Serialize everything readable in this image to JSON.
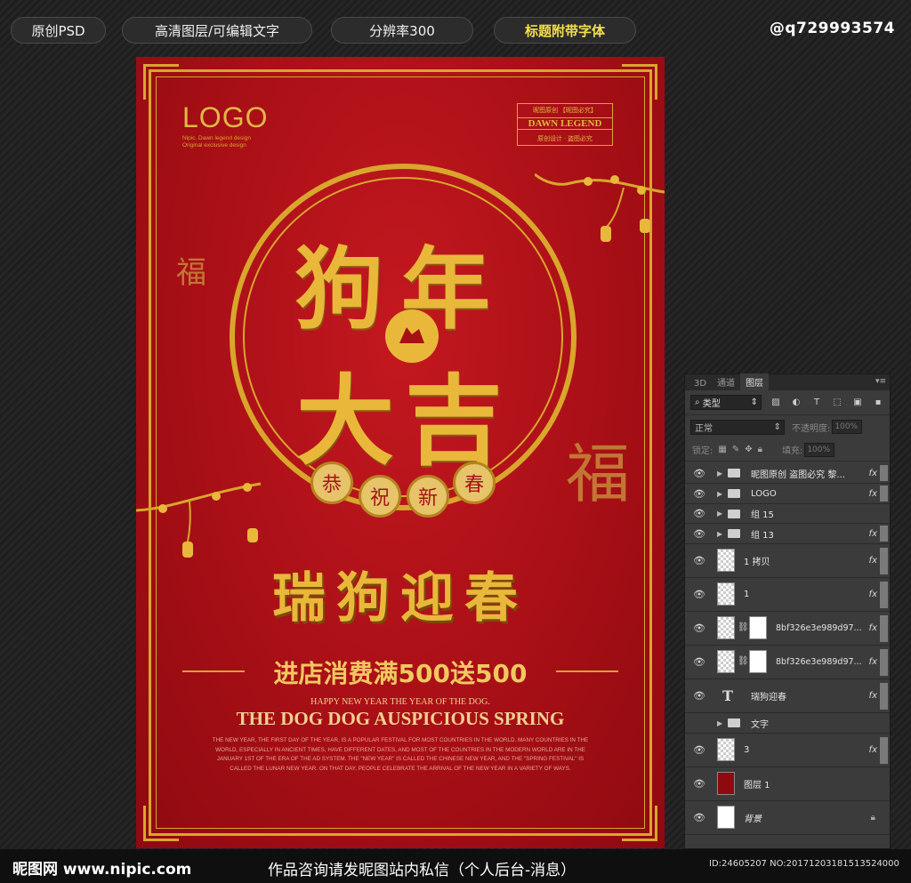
{
  "top_bar": {
    "pills": [
      "原创PSD",
      "高清图层/可编辑文字",
      "分辨率300",
      "标题附带字体"
    ],
    "handle": "@q729993574"
  },
  "poster": {
    "logo": "LOGO",
    "logo_sub": [
      "Nipic. Dawn legend design",
      "Original exclusive design"
    ],
    "dawn_box": {
      "line1": "昵图原创 【昵图必究】",
      "line2": "DAWN LEGEND",
      "line3": "原创设计 · 盗图必究"
    },
    "fu_char": "福",
    "title_chars": [
      "狗",
      "年",
      "大",
      "吉"
    ],
    "coins": [
      "恭",
      "祝",
      "新",
      "春"
    ],
    "slogan": "瑞狗迎春",
    "promo": "进店消费满500送500",
    "happy_line": "HAPPY NEW YEAR THE YEAR OF THE DOG.",
    "spring_line": "THE DOG DOG AUSPICIOUS SPRING",
    "paragraph": "THE NEW YEAR, THE FIRST DAY OF THE YEAR, IS A POPULAR FESTIVAL FOR MOST COUNTRIES IN THE WORLD. MANY COUNTRIES IN THE WORLD, ESPECIALLY IN ANCIENT TIMES, HAVE DIFFERENT DATES, AND MOST OF THE COUNTRIES IN THE MODERN WORLD ARE IN THE JANUARY 1ST OF THE ERA OF THE AD SYSTEM. THE \"NEW YEAR\" IS CALLED THE CHINESE NEW YEAR, AND THE \"SPRING FESTIVAL\" IS CALLED THE LUNAR NEW YEAR. ON THAT DAY, PEOPLE CELEBRATE THE ARRIVAL OF THE NEW YEAR IN A VARIETY OF WAYS."
  },
  "layers_panel": {
    "tabs": [
      "3D",
      "通道",
      "图层"
    ],
    "kind_select": "类型",
    "blend_mode": "正常",
    "opacity_label": "不透明度:",
    "opacity_value": "100%",
    "lock_label": "锁定:",
    "fill_label": "填充:",
    "fill_value": "100%",
    "fx_label": "fx",
    "text_layer_glyph": "T",
    "layers": [
      {
        "name": "昵图原创 盗图必究 黎..."
      },
      {
        "name": "LOGO"
      },
      {
        "name": "组 15"
      },
      {
        "name": "组 13"
      },
      {
        "name": "1 拷贝"
      },
      {
        "name": "1"
      },
      {
        "name": "8bf326e3e989d97..."
      },
      {
        "name": "8bf326e3e989d97..."
      },
      {
        "name": "瑞狗迎春"
      },
      {
        "name": "文字"
      },
      {
        "name": "3"
      },
      {
        "name": "图层 1"
      },
      {
        "name": "背景"
      }
    ]
  },
  "bottom_bar": {
    "site": "昵图网 www.nipic.com",
    "notice": "作品咨询请发昵图站内私信（个人后台-消息）",
    "image_id": "ID:24605207 NO:20171203181513524000"
  },
  "colors": {
    "gold": "#d9a62c",
    "poster_red": "#b3121a",
    "panel_bg": "#3b3b3b"
  }
}
